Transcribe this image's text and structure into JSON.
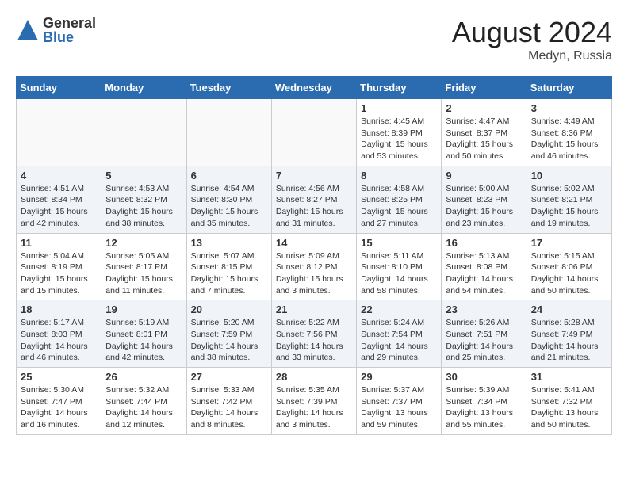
{
  "header": {
    "logo": {
      "general": "General",
      "blue": "Blue"
    },
    "title": "August 2024",
    "subtitle": "Medyn, Russia"
  },
  "weekdays": [
    "Sunday",
    "Monday",
    "Tuesday",
    "Wednesday",
    "Thursday",
    "Friday",
    "Saturday"
  ],
  "weeks": [
    [
      {
        "day": "",
        "info": ""
      },
      {
        "day": "",
        "info": ""
      },
      {
        "day": "",
        "info": ""
      },
      {
        "day": "",
        "info": ""
      },
      {
        "day": "1",
        "info": "Sunrise: 4:45 AM\nSunset: 8:39 PM\nDaylight: 15 hours\nand 53 minutes."
      },
      {
        "day": "2",
        "info": "Sunrise: 4:47 AM\nSunset: 8:37 PM\nDaylight: 15 hours\nand 50 minutes."
      },
      {
        "day": "3",
        "info": "Sunrise: 4:49 AM\nSunset: 8:36 PM\nDaylight: 15 hours\nand 46 minutes."
      }
    ],
    [
      {
        "day": "4",
        "info": "Sunrise: 4:51 AM\nSunset: 8:34 PM\nDaylight: 15 hours\nand 42 minutes."
      },
      {
        "day": "5",
        "info": "Sunrise: 4:53 AM\nSunset: 8:32 PM\nDaylight: 15 hours\nand 38 minutes."
      },
      {
        "day": "6",
        "info": "Sunrise: 4:54 AM\nSunset: 8:30 PM\nDaylight: 15 hours\nand 35 minutes."
      },
      {
        "day": "7",
        "info": "Sunrise: 4:56 AM\nSunset: 8:27 PM\nDaylight: 15 hours\nand 31 minutes."
      },
      {
        "day": "8",
        "info": "Sunrise: 4:58 AM\nSunset: 8:25 PM\nDaylight: 15 hours\nand 27 minutes."
      },
      {
        "day": "9",
        "info": "Sunrise: 5:00 AM\nSunset: 8:23 PM\nDaylight: 15 hours\nand 23 minutes."
      },
      {
        "day": "10",
        "info": "Sunrise: 5:02 AM\nSunset: 8:21 PM\nDaylight: 15 hours\nand 19 minutes."
      }
    ],
    [
      {
        "day": "11",
        "info": "Sunrise: 5:04 AM\nSunset: 8:19 PM\nDaylight: 15 hours\nand 15 minutes."
      },
      {
        "day": "12",
        "info": "Sunrise: 5:05 AM\nSunset: 8:17 PM\nDaylight: 15 hours\nand 11 minutes."
      },
      {
        "day": "13",
        "info": "Sunrise: 5:07 AM\nSunset: 8:15 PM\nDaylight: 15 hours\nand 7 minutes."
      },
      {
        "day": "14",
        "info": "Sunrise: 5:09 AM\nSunset: 8:12 PM\nDaylight: 15 hours\nand 3 minutes."
      },
      {
        "day": "15",
        "info": "Sunrise: 5:11 AM\nSunset: 8:10 PM\nDaylight: 14 hours\nand 58 minutes."
      },
      {
        "day": "16",
        "info": "Sunrise: 5:13 AM\nSunset: 8:08 PM\nDaylight: 14 hours\nand 54 minutes."
      },
      {
        "day": "17",
        "info": "Sunrise: 5:15 AM\nSunset: 8:06 PM\nDaylight: 14 hours\nand 50 minutes."
      }
    ],
    [
      {
        "day": "18",
        "info": "Sunrise: 5:17 AM\nSunset: 8:03 PM\nDaylight: 14 hours\nand 46 minutes."
      },
      {
        "day": "19",
        "info": "Sunrise: 5:19 AM\nSunset: 8:01 PM\nDaylight: 14 hours\nand 42 minutes."
      },
      {
        "day": "20",
        "info": "Sunrise: 5:20 AM\nSunset: 7:59 PM\nDaylight: 14 hours\nand 38 minutes."
      },
      {
        "day": "21",
        "info": "Sunrise: 5:22 AM\nSunset: 7:56 PM\nDaylight: 14 hours\nand 33 minutes."
      },
      {
        "day": "22",
        "info": "Sunrise: 5:24 AM\nSunset: 7:54 PM\nDaylight: 14 hours\nand 29 minutes."
      },
      {
        "day": "23",
        "info": "Sunrise: 5:26 AM\nSunset: 7:51 PM\nDaylight: 14 hours\nand 25 minutes."
      },
      {
        "day": "24",
        "info": "Sunrise: 5:28 AM\nSunset: 7:49 PM\nDaylight: 14 hours\nand 21 minutes."
      }
    ],
    [
      {
        "day": "25",
        "info": "Sunrise: 5:30 AM\nSunset: 7:47 PM\nDaylight: 14 hours\nand 16 minutes."
      },
      {
        "day": "26",
        "info": "Sunrise: 5:32 AM\nSunset: 7:44 PM\nDaylight: 14 hours\nand 12 minutes."
      },
      {
        "day": "27",
        "info": "Sunrise: 5:33 AM\nSunset: 7:42 PM\nDaylight: 14 hours\nand 8 minutes."
      },
      {
        "day": "28",
        "info": "Sunrise: 5:35 AM\nSunset: 7:39 PM\nDaylight: 14 hours\nand 3 minutes."
      },
      {
        "day": "29",
        "info": "Sunrise: 5:37 AM\nSunset: 7:37 PM\nDaylight: 13 hours\nand 59 minutes."
      },
      {
        "day": "30",
        "info": "Sunrise: 5:39 AM\nSunset: 7:34 PM\nDaylight: 13 hours\nand 55 minutes."
      },
      {
        "day": "31",
        "info": "Sunrise: 5:41 AM\nSunset: 7:32 PM\nDaylight: 13 hours\nand 50 minutes."
      }
    ]
  ]
}
